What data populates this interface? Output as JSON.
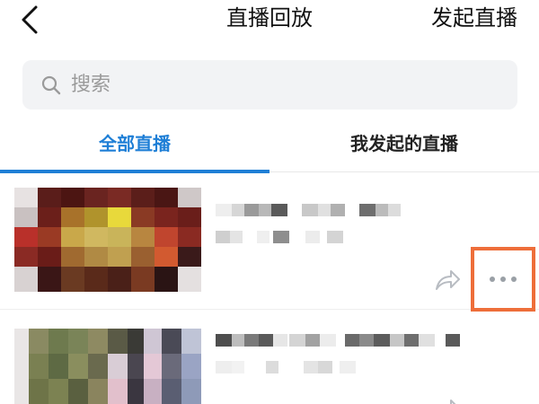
{
  "header": {
    "back_icon": "chevron-left-icon",
    "title": "直播回放",
    "launch_label": "发起直播"
  },
  "search": {
    "icon": "search-icon",
    "placeholder": "搜索"
  },
  "tabs": [
    {
      "label": "全部直播",
      "active": true
    },
    {
      "label": "我发起的直播",
      "active": false
    }
  ],
  "items": [
    {
      "thumbnail": "pixelated-video-thumbnail",
      "title": "",
      "subtitle": "",
      "share_icon": "share-icon",
      "more_icon": "more-dots-icon",
      "more_highlighted": true
    },
    {
      "thumbnail": "pixelated-video-thumbnail",
      "title": "",
      "subtitle": "",
      "share_icon": "share-icon"
    }
  ],
  "colors": {
    "accent": "#1f7fd6",
    "highlight": "#ee6e3a",
    "search_bg": "#f2f3f5"
  }
}
